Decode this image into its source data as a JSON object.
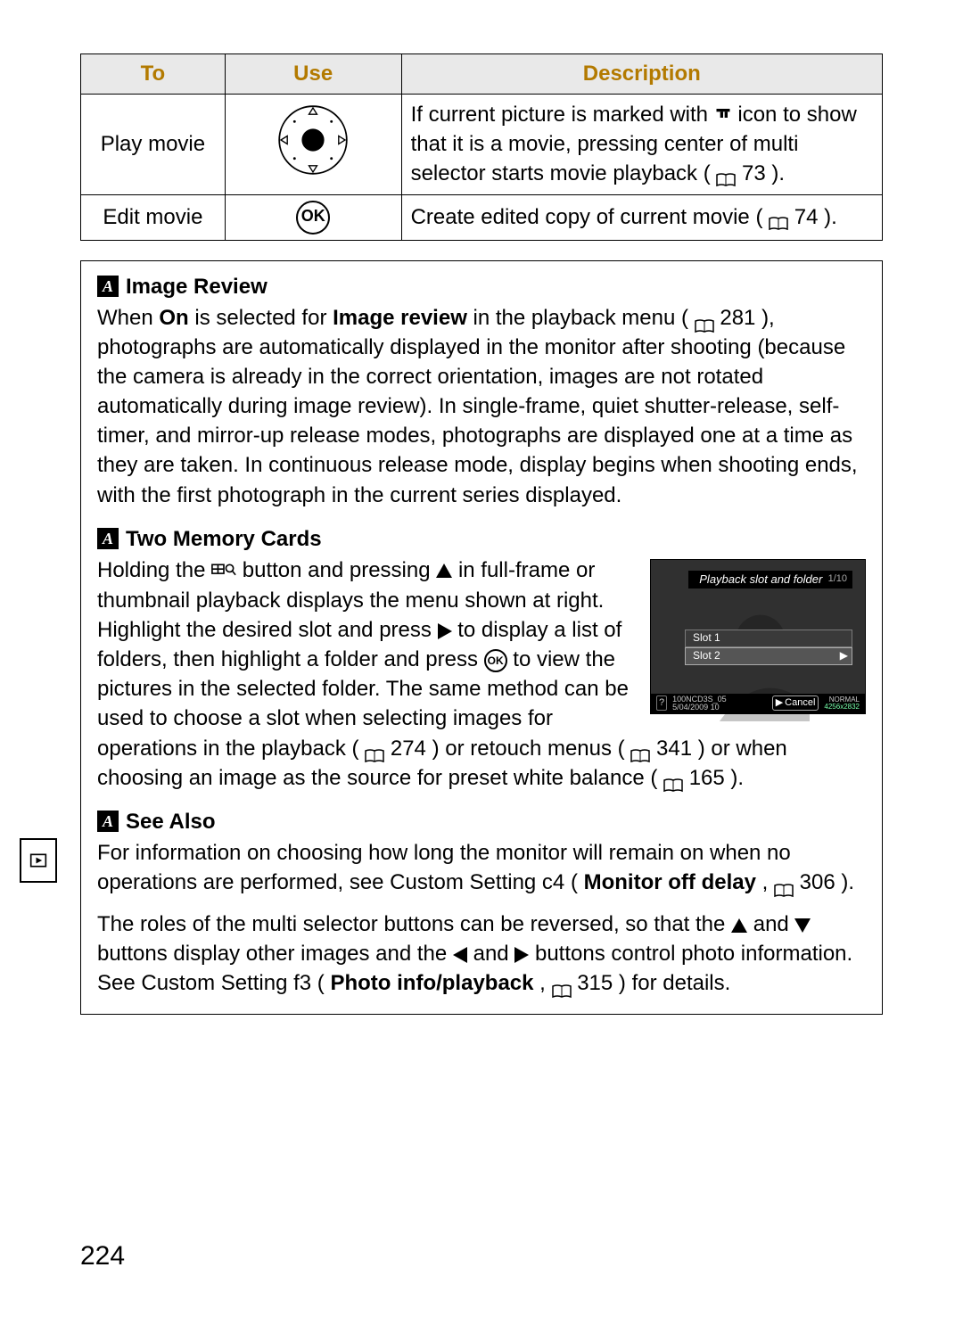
{
  "table": {
    "headers": {
      "to": "To",
      "use": "Use",
      "desc": "Description"
    },
    "rows": [
      {
        "to": "Play movie",
        "use_kind": "multi_selector",
        "desc_pre": "If current picture is marked with ",
        "desc_mid": " icon to show that it is a movie, pressing center of multi selector starts movie playback (",
        "desc_ref": "73",
        "desc_post": ")."
      },
      {
        "to": "Edit movie",
        "use_kind": "ok_button",
        "use_label": "OK",
        "desc_pre": "Create edited copy of current movie (",
        "desc_ref": "74",
        "desc_post": ")."
      }
    ]
  },
  "image_review": {
    "title": "Image Review",
    "t1": "When ",
    "t2_bold": "On",
    "t3": " is selected for ",
    "t4_bold": "Image review",
    "t5": " in the playback menu (",
    "t5_ref": "281",
    "t6": "), photographs are automatically displayed in the monitor after shooting (because the camera is already in the correct orientation, images are not rotated automatically during image review).  In single-frame, quiet shutter-release, self-timer, and mirror-up release modes, photographs are displayed one at a time as they are taken.  In continuous release mode, display begins when shooting ends, with the first photograph in the current series displayed."
  },
  "two_cards": {
    "title": "Two Memory Cards",
    "p1a": "Holding the ",
    "p1b": " button and pressing ",
    "p1c": " in full-frame or thumbnail playback displays the menu shown at right. Highlight the desired slot and press ",
    "p1d": " to display a list of folders, then highlight a folder and press ",
    "p1e": " to view the pictures in the selected folder. The same method can be used to choose a slot when selecting images for operations in the playback (",
    "p1_ref1": "274",
    "p1f": ") or retouch menus (",
    "p1_ref2": "341",
    "p1g": ") or when choosing an image as the source for preset white balance (",
    "p1_ref3": "165",
    "p1h": ")."
  },
  "see_also": {
    "title": "See Also",
    "p1a": "For information on choosing how long the monitor will remain on when no operations are performed, see Custom Setting c4 (",
    "p1b_bold": "Monitor off delay",
    "p1c": ", ",
    "p1_ref": "306",
    "p1d": ").",
    "p2a": "The roles of the multi selector buttons can be reversed, so that the ",
    "p2b": " and ",
    "p2c": " buttons display other images and the ",
    "p2d": " and ",
    "p2e": " buttons control photo information. See Custom Setting f3 (",
    "p2f_bold": "Photo info/playback",
    "p2g": ", ",
    "p2_ref": "315",
    "p2h": ") for details."
  },
  "screen": {
    "title": "Playback slot and folder",
    "count": "1/10",
    "slot1": "Slot 1",
    "slot2": "Slot 2",
    "cancel": "Cancel",
    "footer_left": "100NCD3S_05",
    "footer_date": "5/04/2009 10",
    "footer_right1": "NORMAL",
    "footer_right2": "4256x2832"
  },
  "page_number": "224"
}
